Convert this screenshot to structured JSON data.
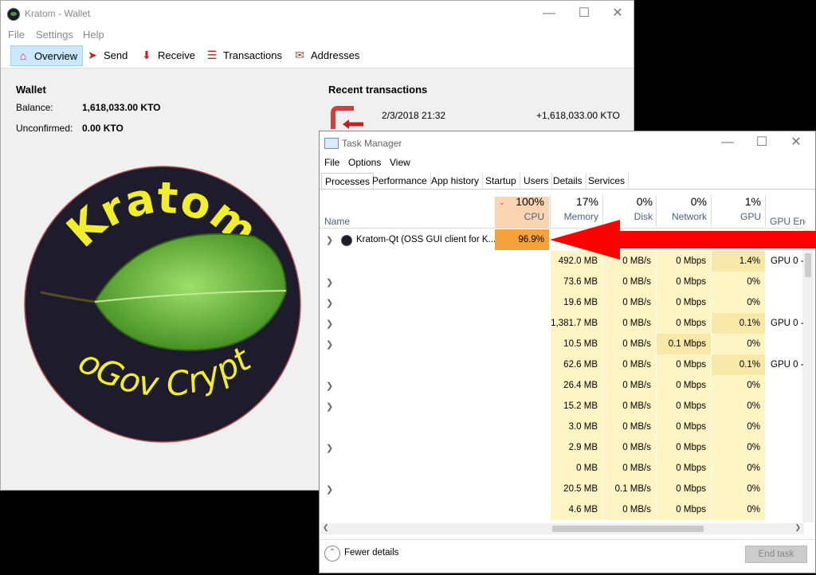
{
  "wallet": {
    "title": "Kratom - Wallet",
    "menu": [
      "File",
      "Settings",
      "Help"
    ],
    "toolbar": {
      "overview": "Overview",
      "send": "Send",
      "receive": "Receive",
      "transactions": "Transactions",
      "addresses": "Addresses"
    },
    "overview": {
      "heading": "Wallet",
      "balance_label": "Balance:",
      "balance_value": "1,618,033.00 KTO",
      "unconfirmed_label": "Unconfirmed:",
      "unconfirmed_value": "0.00 KTO"
    },
    "recent": {
      "heading": "Recent transactions",
      "date": "2/3/2018 21:32",
      "amount": "+1,618,033.00 KTO"
    },
    "logo": {
      "top_text": "Kratom",
      "bottom_text": "NoGov Crypto"
    }
  },
  "taskmgr": {
    "title": "Task Manager",
    "menu": [
      "File",
      "Options",
      "View"
    ],
    "tabs": [
      "Processes",
      "Performance",
      "App history",
      "Startup",
      "Users",
      "Details",
      "Services"
    ],
    "columns": {
      "name": "Name",
      "cpu_pct": "100%",
      "cpu": "CPU",
      "mem_pct": "17%",
      "memory": "Memory",
      "disk_pct": "0%",
      "disk": "Disk",
      "net_pct": "0%",
      "network": "Network",
      "gpu_pct": "1%",
      "gpu": "GPU",
      "gpu_engine": "GPU Engine"
    },
    "first_row": {
      "name": "Kratom-Qt (OSS GUI client for K...",
      "cpu": "96.9%"
    },
    "rows": [
      {
        "mem": "492.0 MB",
        "disk": "0 MB/s",
        "net": "0 Mbps",
        "gpu": "1.4%",
        "eng": "GPU 0 -"
      },
      {
        "mem": "73.6 MB",
        "disk": "0 MB/s",
        "net": "0 Mbps",
        "gpu": "0%",
        "eng": ""
      },
      {
        "mem": "19.6 MB",
        "disk": "0 MB/s",
        "net": "0 Mbps",
        "gpu": "0%",
        "eng": ""
      },
      {
        "mem": "1,381.7 MB",
        "disk": "0 MB/s",
        "net": "0 Mbps",
        "gpu": "0.1%",
        "eng": "GPU 0 -"
      },
      {
        "mem": "10.5 MB",
        "disk": "0 MB/s",
        "net": "0.1 Mbps",
        "gpu": "0%",
        "eng": ""
      },
      {
        "mem": "62.6 MB",
        "disk": "0 MB/s",
        "net": "0 Mbps",
        "gpu": "0.1%",
        "eng": "GPU 0 -"
      },
      {
        "mem": "26.4 MB",
        "disk": "0 MB/s",
        "net": "0 Mbps",
        "gpu": "0%",
        "eng": ""
      },
      {
        "mem": "15.2 MB",
        "disk": "0 MB/s",
        "net": "0 Mbps",
        "gpu": "0%",
        "eng": ""
      },
      {
        "mem": "3.0 MB",
        "disk": "0 MB/s",
        "net": "0 Mbps",
        "gpu": "0%",
        "eng": ""
      },
      {
        "mem": "2.9 MB",
        "disk": "0 MB/s",
        "net": "0 Mbps",
        "gpu": "0%",
        "eng": ""
      },
      {
        "mem": "0 MB",
        "disk": "0 MB/s",
        "net": "0 Mbps",
        "gpu": "0%",
        "eng": ""
      },
      {
        "mem": "20.5 MB",
        "disk": "0.1 MB/s",
        "net": "0 Mbps",
        "gpu": "0%",
        "eng": ""
      },
      {
        "mem": "4.6 MB",
        "disk": "0 MB/s",
        "net": "0 Mbps",
        "gpu": "0%",
        "eng": ""
      }
    ],
    "fewer_details": "Fewer details",
    "end_task": "End task"
  },
  "colors": {
    "cpu_highlight": "#f5a23d",
    "arrow": "#ff0000",
    "tab_select": "#cce8ff"
  }
}
